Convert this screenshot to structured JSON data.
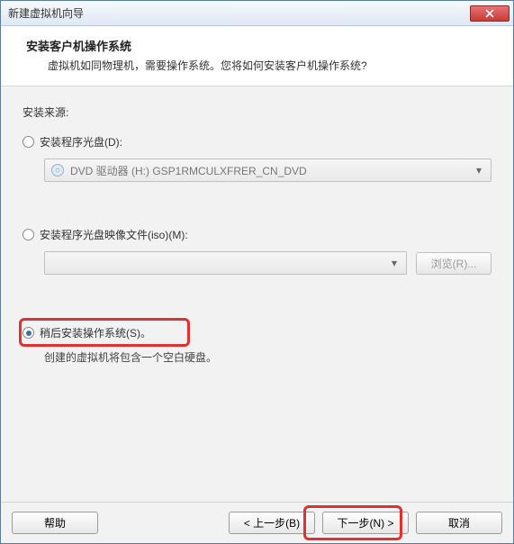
{
  "window": {
    "title": "新建虚拟机向导"
  },
  "header": {
    "title": "安装客户机操作系统",
    "subtitle": "虚拟机如同物理机，需要操作系统。您将如何安装客户机操作系统?"
  },
  "body": {
    "source_label": "安装来源:",
    "option_disc": {
      "label": "安装程序光盘(D):",
      "dropdown_value": "DVD 驱动器 (H:) GSP1RMCULXFRER_CN_DVD",
      "selected": false
    },
    "option_iso": {
      "label": "安装程序光盘映像文件(iso)(M):",
      "dropdown_value": "",
      "browse_label": "浏览(R)...",
      "selected": false
    },
    "option_later": {
      "label": "稍后安装操作系统(S)。",
      "hint": "创建的虚拟机将包含一个空白硬盘。",
      "selected": true
    }
  },
  "footer": {
    "help": "帮助",
    "back": "< 上一步(B)",
    "next": "下一步(N) >",
    "cancel": "取消"
  }
}
